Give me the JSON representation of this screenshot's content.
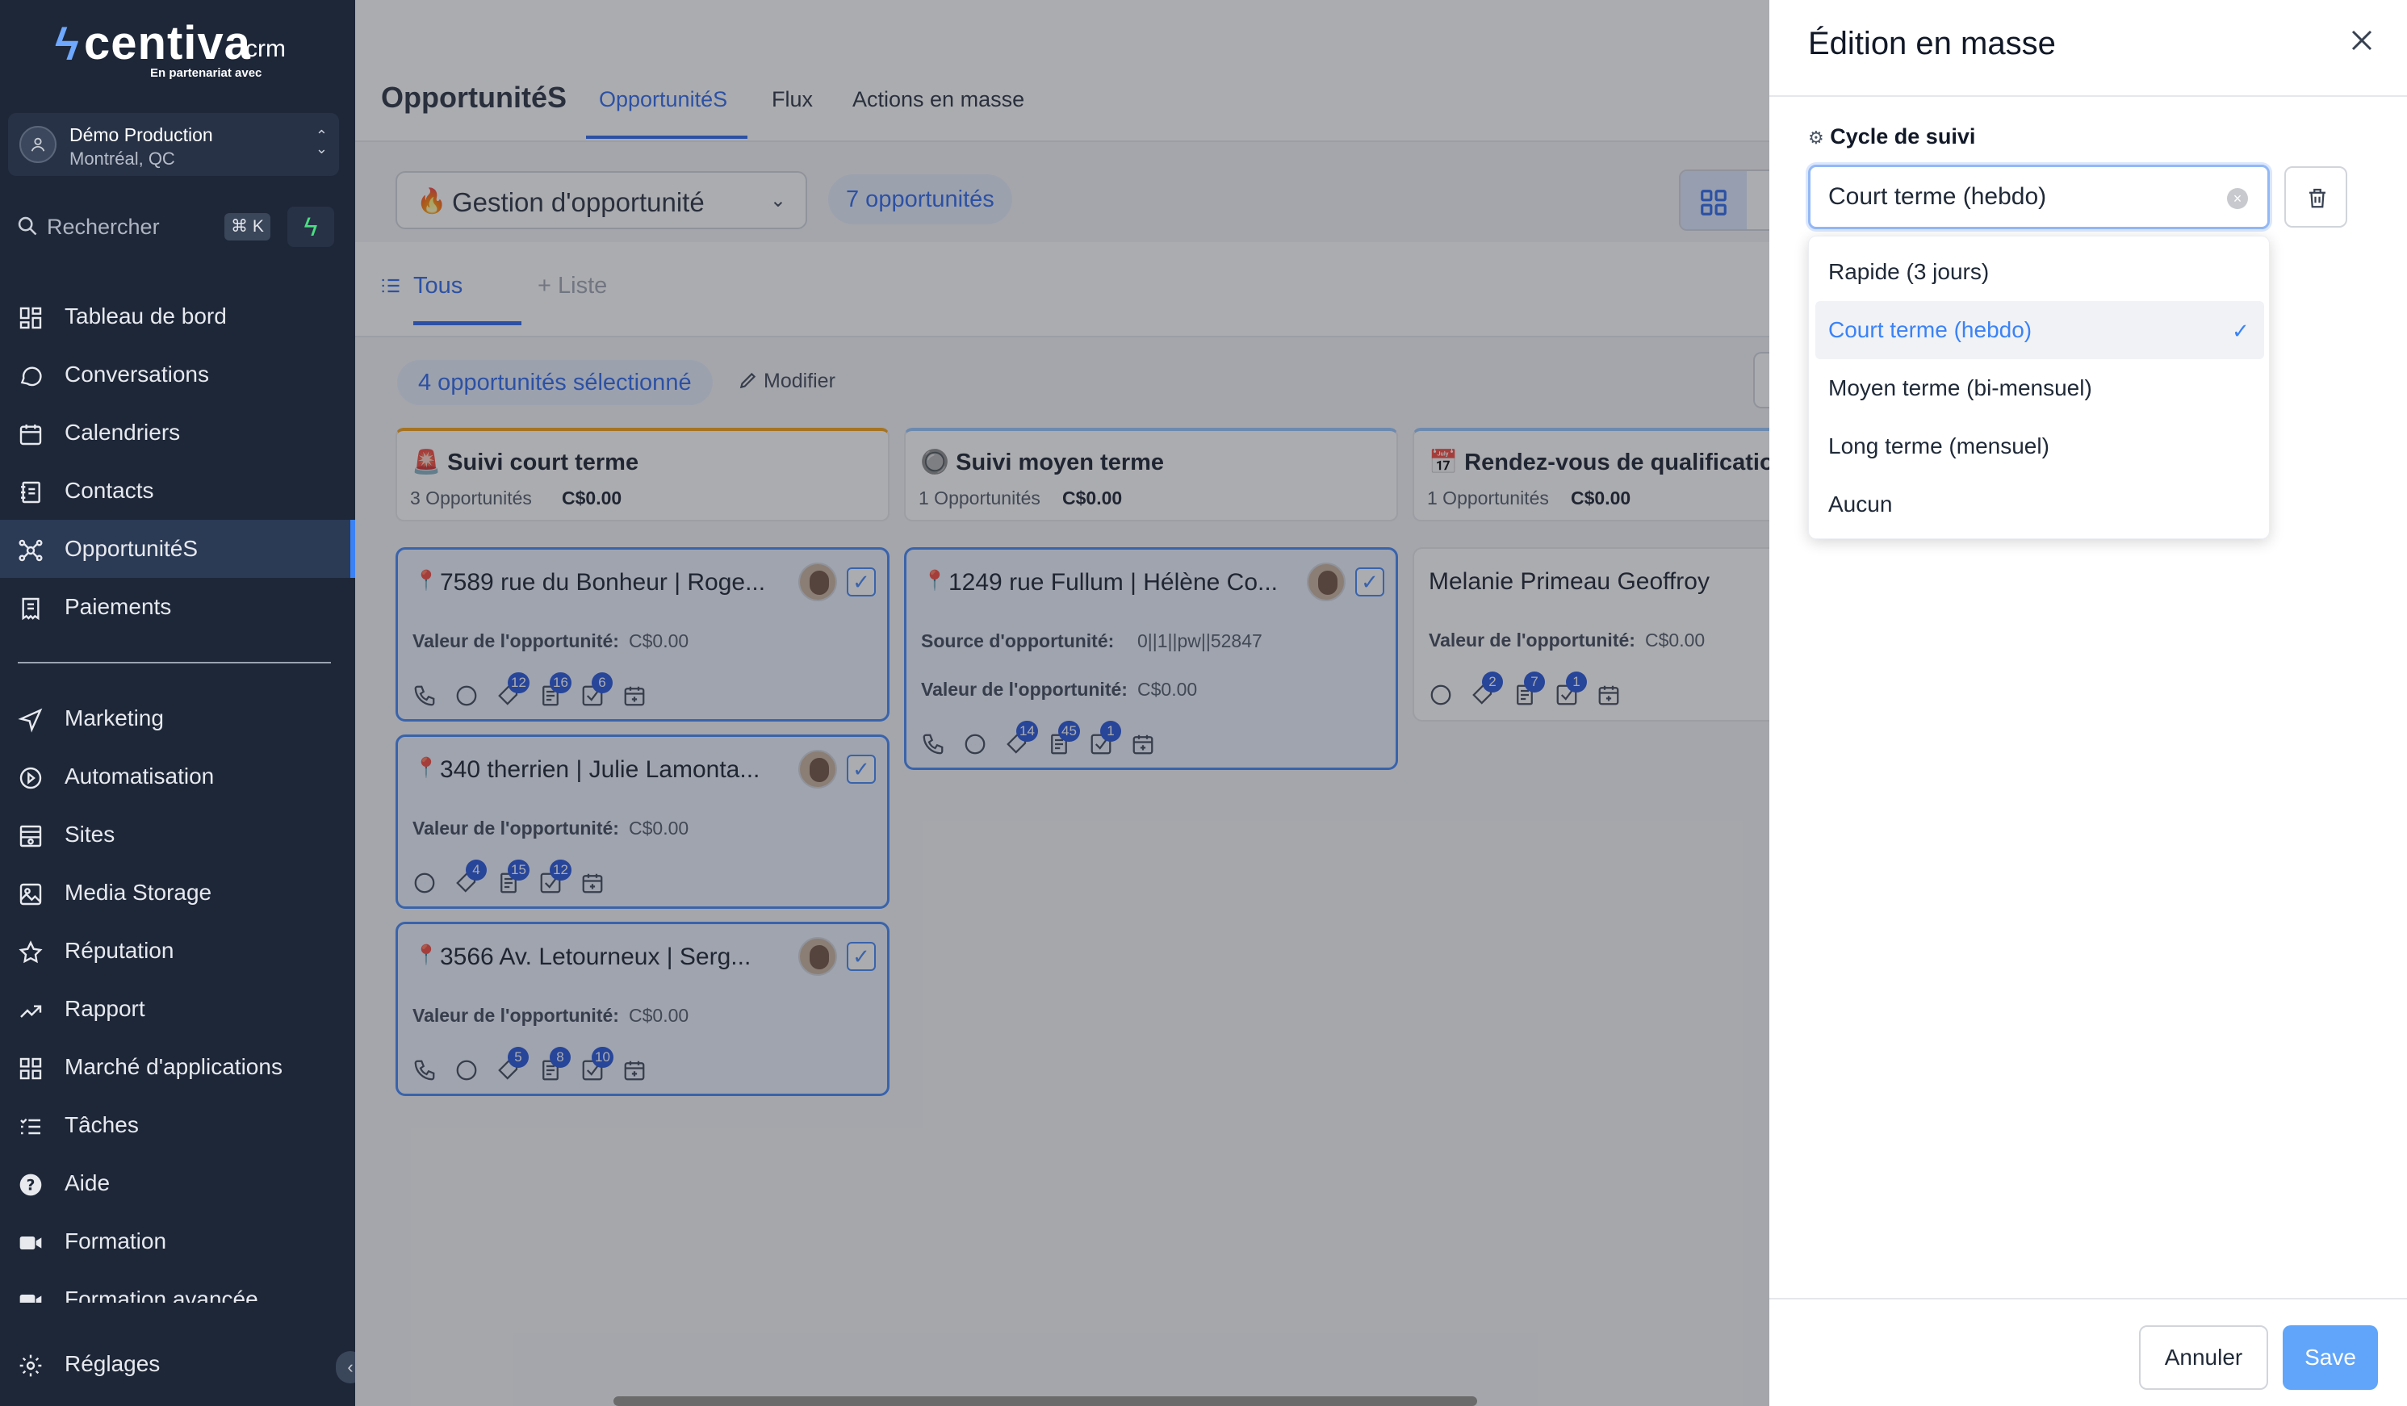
{
  "app": {
    "logo_name": "centiva",
    "logo_suffix": "crm",
    "logo_tagline": "En partenariat avec"
  },
  "account": {
    "name": "Démo Production",
    "location": "Montréal, QC"
  },
  "search": {
    "placeholder": "Rechercher",
    "shortcut": "⌘ K"
  },
  "sidebar": {
    "items": [
      {
        "label": "Tableau de bord",
        "icon": "dashboard-icon"
      },
      {
        "label": "Conversations",
        "icon": "chat-icon"
      },
      {
        "label": "Calendriers",
        "icon": "calendar-icon"
      },
      {
        "label": "Contacts",
        "icon": "contacts-icon"
      },
      {
        "label": "OpportunitéS",
        "icon": "opportunities-icon",
        "active": true
      },
      {
        "label": "Paiements",
        "icon": "payments-icon"
      }
    ],
    "items2": [
      {
        "label": "Marketing",
        "icon": "send-icon"
      },
      {
        "label": "Automatisation",
        "icon": "automation-icon"
      },
      {
        "label": "Sites",
        "icon": "sites-icon"
      },
      {
        "label": "Media Storage",
        "icon": "image-icon"
      },
      {
        "label": "Réputation",
        "icon": "star-icon"
      },
      {
        "label": "Rapport",
        "icon": "trend-icon"
      },
      {
        "label": "Marché d'applications",
        "icon": "apps-icon"
      },
      {
        "label": "Tâches",
        "icon": "tasks-icon"
      },
      {
        "label": "Aide",
        "icon": "help-icon"
      },
      {
        "label": "Formation",
        "icon": "video-icon"
      },
      {
        "label": "Formation avancée",
        "icon": "video-icon"
      }
    ],
    "settings_label": "Réglages"
  },
  "header": {
    "title": "OpportunitéS",
    "tabs": [
      "OpportunitéS",
      "Flux",
      "Actions en masse"
    ]
  },
  "toolbar": {
    "pipeline": "Gestion d'opportunité",
    "count": "7 opportunités"
  },
  "subtabs": {
    "all": "Tous",
    "add": "Liste"
  },
  "selection": {
    "badge": "4 opportunités sélectionné",
    "modify": "Modifier"
  },
  "columns": [
    {
      "emoji": "🚨",
      "name": "Suivi court terme",
      "count": "3 Opportunités",
      "amount": "C$0.00",
      "cards": [
        {
          "title": "7589 rue du Bonheur | Roge...",
          "field_label": "Valeur de l'opportunité:",
          "field_value": "C$0.00",
          "badges": [
            "12",
            "16",
            "6"
          ]
        },
        {
          "title": "340 therrien | Julie Lamonta...",
          "field_label": "Valeur de l'opportunité:",
          "field_value": "C$0.00",
          "badges": [
            "4",
            "15",
            "12"
          ]
        },
        {
          "title": "3566 Av. Letourneux | Serg...",
          "field_label": "Valeur de l'opportunité:",
          "field_value": "C$0.00",
          "badges": [
            "5",
            "8",
            "10"
          ]
        }
      ]
    },
    {
      "emoji": "🔘",
      "name": "Suivi moyen terme",
      "count": "1 Opportunités",
      "amount": "C$0.00",
      "cards": [
        {
          "title": "1249 rue Fullum | Hélène Co...",
          "source_label": "Source d'opportunité:",
          "source_value": "0||1||pw||52847",
          "field_label": "Valeur de l'opportunité:",
          "field_value": "C$0.00",
          "badges": [
            "14",
            "45",
            "1"
          ]
        }
      ]
    },
    {
      "emoji": "📅",
      "name": "Rendez-vous de qualification",
      "count": "1 Opportunités",
      "amount": "C$0.00",
      "cards": [
        {
          "title": "Melanie Primeau Geoffroy",
          "field_label": "Valeur de l'opportunité:",
          "field_value": "C$0.00",
          "badges": [
            "2",
            "7",
            "1"
          ]
        }
      ]
    }
  ],
  "drawer": {
    "title": "Édition en masse",
    "field_label": "Cycle de suivi",
    "selected_value": "Court terme (hebdo)",
    "options": [
      "Rapide (3 jours)",
      "Court terme (hebdo)",
      "Moyen terme (bi-mensuel)",
      "Long terme (mensuel)",
      "Aucun"
    ],
    "cancel": "Annuler",
    "save": "Save"
  },
  "colors": {
    "accent": "#2563eb",
    "sidebar_bg": "#1d2738",
    "save_bg": "#60a5fa"
  }
}
